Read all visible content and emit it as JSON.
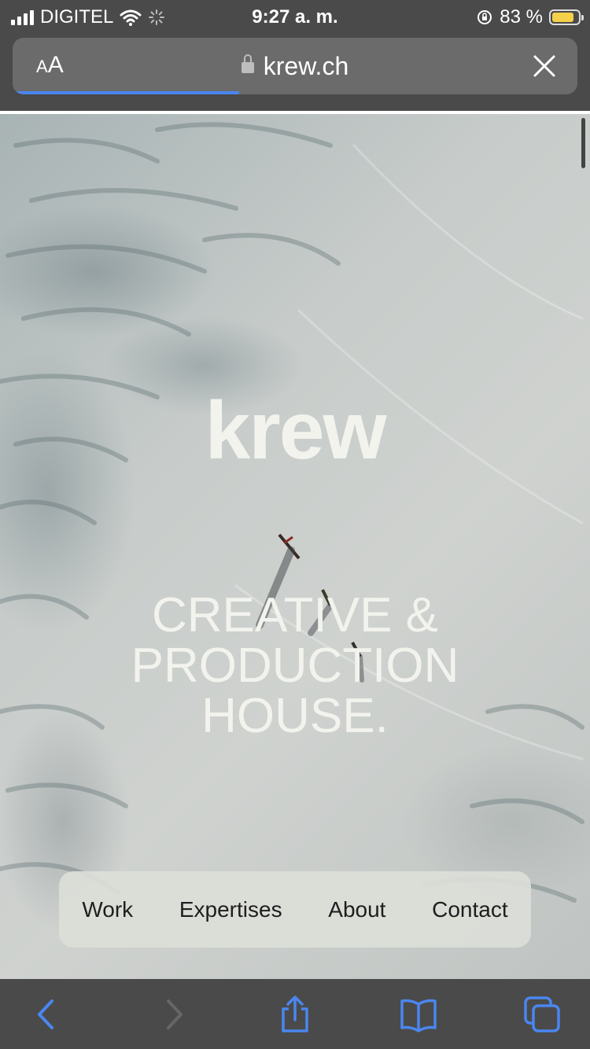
{
  "status_bar": {
    "carrier": "DIGITEL",
    "time": "9:27 a. m.",
    "battery_percent": "83 %",
    "battery_level": 0.83,
    "battery_color": "#f5d04a"
  },
  "address_bar": {
    "text_size_label": "AA",
    "url": "krew.ch",
    "load_progress": 0.4,
    "icons": [
      "lock-icon",
      "close-icon"
    ]
  },
  "page": {
    "brand": "krew",
    "tagline_lines": [
      "CREATIVE &",
      "PRODUCTION",
      "HOUSE."
    ]
  },
  "nav": {
    "items": [
      "Work",
      "Expertises",
      "About",
      "Contact"
    ]
  },
  "toolbar": {
    "icons": [
      "back-icon",
      "forward-icon",
      "share-icon",
      "bookmarks-icon",
      "tabs-icon"
    ],
    "accent": "#4a86f0"
  }
}
